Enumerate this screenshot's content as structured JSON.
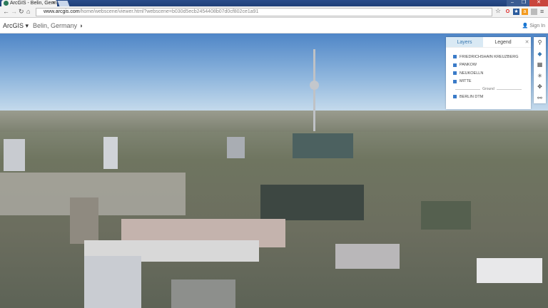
{
  "browser": {
    "tab_title": "ArcGIS - Belin, Germ",
    "url_domain": "www.arcgis.com",
    "url_path": "/home/webscene/viewer.html?webscene=b030d5ecb2454408b07d0cf802ce1a91"
  },
  "app": {
    "brand": "ArcGIS",
    "scene_title": "Belin, Germany",
    "sign_in": "Sign In"
  },
  "panel": {
    "tabs": [
      "Layers",
      "Legend"
    ],
    "active_tab": "Layers",
    "layers": [
      "FRIEDRICHSHAIN KREUZBERG",
      "PANKOW",
      "NEUKOELLN",
      "MITTE"
    ],
    "ground_label": "Ground",
    "ground_layers": [
      "BERLIN DTM"
    ]
  },
  "tools": [
    "search-icon",
    "layers-icon",
    "basemap-icon",
    "daylight-icon",
    "navigate-icon",
    "slides-icon"
  ],
  "colors": {
    "accent": "#3a78b0",
    "checkbox": "#3a7bc8"
  }
}
